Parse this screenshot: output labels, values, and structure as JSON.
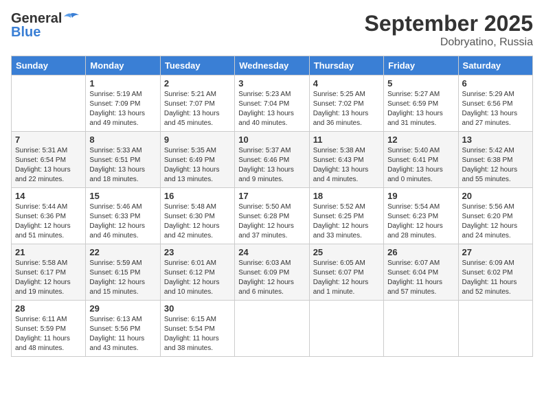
{
  "header": {
    "logo_general": "General",
    "logo_blue": "Blue",
    "month": "September 2025",
    "location": "Dobryatino, Russia"
  },
  "days_of_week": [
    "Sunday",
    "Monday",
    "Tuesday",
    "Wednesday",
    "Thursday",
    "Friday",
    "Saturday"
  ],
  "weeks": [
    [
      {
        "day": "",
        "info": ""
      },
      {
        "day": "1",
        "info": "Sunrise: 5:19 AM\nSunset: 7:09 PM\nDaylight: 13 hours\nand 49 minutes."
      },
      {
        "day": "2",
        "info": "Sunrise: 5:21 AM\nSunset: 7:07 PM\nDaylight: 13 hours\nand 45 minutes."
      },
      {
        "day": "3",
        "info": "Sunrise: 5:23 AM\nSunset: 7:04 PM\nDaylight: 13 hours\nand 40 minutes."
      },
      {
        "day": "4",
        "info": "Sunrise: 5:25 AM\nSunset: 7:02 PM\nDaylight: 13 hours\nand 36 minutes."
      },
      {
        "day": "5",
        "info": "Sunrise: 5:27 AM\nSunset: 6:59 PM\nDaylight: 13 hours\nand 31 minutes."
      },
      {
        "day": "6",
        "info": "Sunrise: 5:29 AM\nSunset: 6:56 PM\nDaylight: 13 hours\nand 27 minutes."
      }
    ],
    [
      {
        "day": "7",
        "info": "Sunrise: 5:31 AM\nSunset: 6:54 PM\nDaylight: 13 hours\nand 22 minutes."
      },
      {
        "day": "8",
        "info": "Sunrise: 5:33 AM\nSunset: 6:51 PM\nDaylight: 13 hours\nand 18 minutes."
      },
      {
        "day": "9",
        "info": "Sunrise: 5:35 AM\nSunset: 6:49 PM\nDaylight: 13 hours\nand 13 minutes."
      },
      {
        "day": "10",
        "info": "Sunrise: 5:37 AM\nSunset: 6:46 PM\nDaylight: 13 hours\nand 9 minutes."
      },
      {
        "day": "11",
        "info": "Sunrise: 5:38 AM\nSunset: 6:43 PM\nDaylight: 13 hours\nand 4 minutes."
      },
      {
        "day": "12",
        "info": "Sunrise: 5:40 AM\nSunset: 6:41 PM\nDaylight: 13 hours\nand 0 minutes."
      },
      {
        "day": "13",
        "info": "Sunrise: 5:42 AM\nSunset: 6:38 PM\nDaylight: 12 hours\nand 55 minutes."
      }
    ],
    [
      {
        "day": "14",
        "info": "Sunrise: 5:44 AM\nSunset: 6:36 PM\nDaylight: 12 hours\nand 51 minutes."
      },
      {
        "day": "15",
        "info": "Sunrise: 5:46 AM\nSunset: 6:33 PM\nDaylight: 12 hours\nand 46 minutes."
      },
      {
        "day": "16",
        "info": "Sunrise: 5:48 AM\nSunset: 6:30 PM\nDaylight: 12 hours\nand 42 minutes."
      },
      {
        "day": "17",
        "info": "Sunrise: 5:50 AM\nSunset: 6:28 PM\nDaylight: 12 hours\nand 37 minutes."
      },
      {
        "day": "18",
        "info": "Sunrise: 5:52 AM\nSunset: 6:25 PM\nDaylight: 12 hours\nand 33 minutes."
      },
      {
        "day": "19",
        "info": "Sunrise: 5:54 AM\nSunset: 6:23 PM\nDaylight: 12 hours\nand 28 minutes."
      },
      {
        "day": "20",
        "info": "Sunrise: 5:56 AM\nSunset: 6:20 PM\nDaylight: 12 hours\nand 24 minutes."
      }
    ],
    [
      {
        "day": "21",
        "info": "Sunrise: 5:58 AM\nSunset: 6:17 PM\nDaylight: 12 hours\nand 19 minutes."
      },
      {
        "day": "22",
        "info": "Sunrise: 5:59 AM\nSunset: 6:15 PM\nDaylight: 12 hours\nand 15 minutes."
      },
      {
        "day": "23",
        "info": "Sunrise: 6:01 AM\nSunset: 6:12 PM\nDaylight: 12 hours\nand 10 minutes."
      },
      {
        "day": "24",
        "info": "Sunrise: 6:03 AM\nSunset: 6:09 PM\nDaylight: 12 hours\nand 6 minutes."
      },
      {
        "day": "25",
        "info": "Sunrise: 6:05 AM\nSunset: 6:07 PM\nDaylight: 12 hours\nand 1 minute."
      },
      {
        "day": "26",
        "info": "Sunrise: 6:07 AM\nSunset: 6:04 PM\nDaylight: 11 hours\nand 57 minutes."
      },
      {
        "day": "27",
        "info": "Sunrise: 6:09 AM\nSunset: 6:02 PM\nDaylight: 11 hours\nand 52 minutes."
      }
    ],
    [
      {
        "day": "28",
        "info": "Sunrise: 6:11 AM\nSunset: 5:59 PM\nDaylight: 11 hours\nand 48 minutes."
      },
      {
        "day": "29",
        "info": "Sunrise: 6:13 AM\nSunset: 5:56 PM\nDaylight: 11 hours\nand 43 minutes."
      },
      {
        "day": "30",
        "info": "Sunrise: 6:15 AM\nSunset: 5:54 PM\nDaylight: 11 hours\nand 38 minutes."
      },
      {
        "day": "",
        "info": ""
      },
      {
        "day": "",
        "info": ""
      },
      {
        "day": "",
        "info": ""
      },
      {
        "day": "",
        "info": ""
      }
    ]
  ]
}
